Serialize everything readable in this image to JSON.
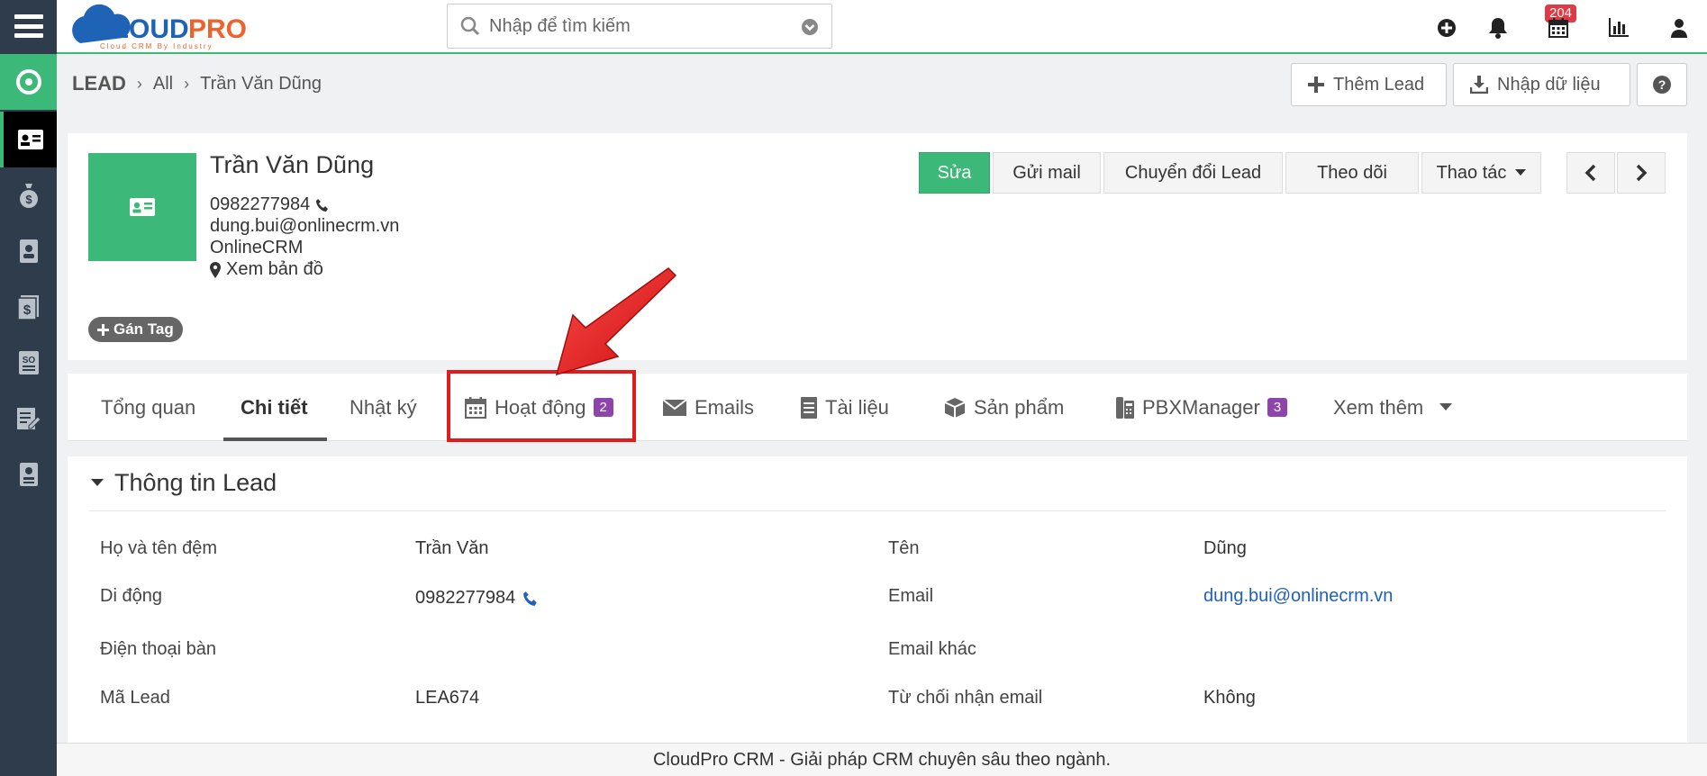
{
  "app": {
    "logo_text": "CLOUDPRO",
    "logo_tagline": "Cloud CRM By Industry",
    "brand_color": "#3cb878"
  },
  "search": {
    "placeholder": "Nhập để tìm kiếm"
  },
  "topbar": {
    "notification_count": "204"
  },
  "breadcrumb": {
    "module": "LEAD",
    "list": "All",
    "record": "Trần Văn Dũng"
  },
  "header_actions": {
    "add_lead": "Thêm Lead",
    "import": "Nhập dữ liệu"
  },
  "record": {
    "name": "Trần Văn Dũng",
    "phone": "0982277984",
    "email": "dung.bui@onlinecrm.vn",
    "company": "OnlineCRM",
    "map_link": "Xem bản đồ",
    "tag_button": "Gán Tag"
  },
  "record_actions": {
    "edit": "Sửa",
    "send_mail": "Gửi mail",
    "convert": "Chuyển đổi Lead",
    "follow": "Theo dõi",
    "more_actions": "Thao tác"
  },
  "tabs": [
    {
      "label": "Tổng quan"
    },
    {
      "label": "Chi tiết"
    },
    {
      "label": "Nhật ký"
    },
    {
      "label": "Hoạt động",
      "badge": "2"
    },
    {
      "label": "Emails"
    },
    {
      "label": "Tài liệu"
    },
    {
      "label": "Sản phẩm"
    },
    {
      "label": "PBXManager",
      "badge": "3"
    },
    {
      "label": "Xem thêm"
    }
  ],
  "section": {
    "title": "Thông tin Lead",
    "fields": {
      "middle_name_label": "Họ và tên đệm",
      "middle_name": "Trần Văn",
      "first_name_label": "Tên",
      "first_name": "Dũng",
      "mobile_label": "Di động",
      "mobile": "0982277984",
      "email_label": "Email",
      "email": "dung.bui@onlinecrm.vn",
      "landline_label": "Điện thoại bàn",
      "other_email_label": "Email khác",
      "lead_code_label": "Mã Lead",
      "lead_code": "LEA674",
      "email_optout_label": "Từ chối nhận email",
      "email_optout": "Không"
    }
  },
  "footer": {
    "text": "CloudPro CRM - Giải pháp CRM chuyên sâu theo ngành."
  }
}
